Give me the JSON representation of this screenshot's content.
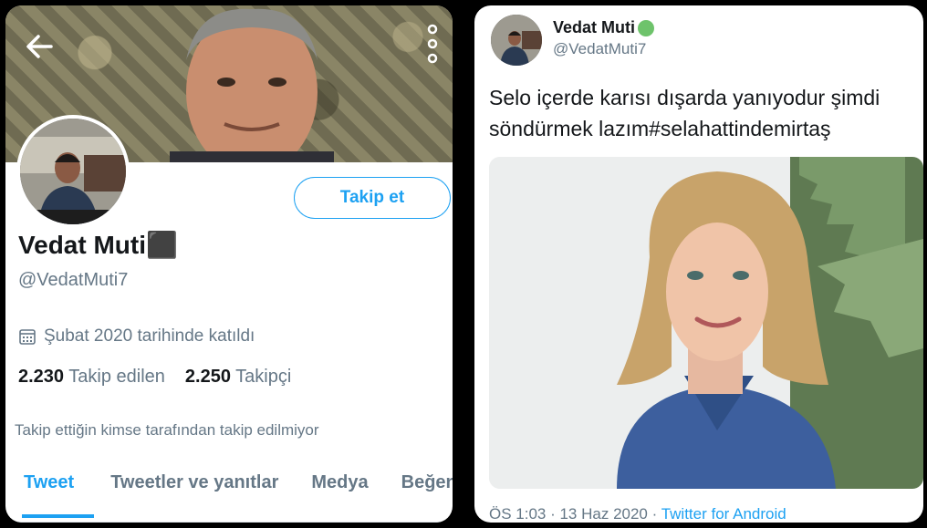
{
  "profile": {
    "display_name": "Vedat Muti⬛",
    "handle": "@VedatMuti7",
    "follow_button": "Takip et",
    "joined": "Şubat 2020 tarihinde katıldı",
    "following_count": "2.230",
    "following_label": "Takip edilen",
    "followers_count": "2.250",
    "followers_label": "Takipçi",
    "not_followed_note": "Takip ettiğin kimse tarafından takip edilmiyor",
    "tabs": [
      {
        "label": "Tweet",
        "active": true
      },
      {
        "label": "Tweetler ve yanıtlar",
        "active": false
      },
      {
        "label": "Medya",
        "active": false
      },
      {
        "label": "Beğen",
        "active": false
      }
    ],
    "icons": {
      "back": "back-arrow-icon",
      "more": "more-vertical-icon",
      "calendar": "calendar-icon"
    }
  },
  "tweet": {
    "author_name": "Vedat Muti",
    "author_handle": "@VedatMuti7",
    "text_line1": "Selo içerde karısı dışarda yanıyodur şimdi",
    "text_line2": "söndürmek lazım#selahattindemirtaş",
    "time": "ÖS 1:03 · 13 Haz 2020 ·",
    "source": "Twitter for Android"
  },
  "colors": {
    "accent": "#1da1f2",
    "text": "#14171a",
    "muted": "#657786",
    "status_dot": "#6ec36b"
  }
}
